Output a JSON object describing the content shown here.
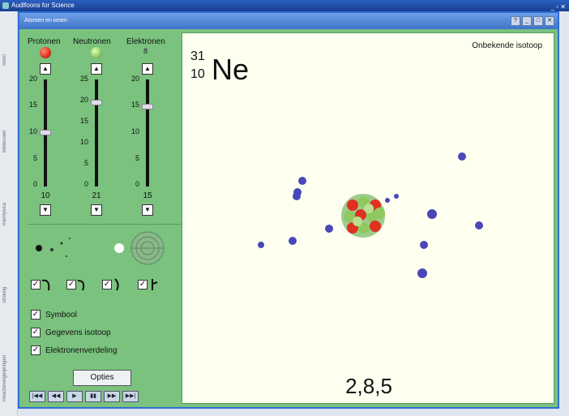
{
  "app": {
    "title": "Audlfoons for Science"
  },
  "window": {
    "title": "Atomen en ionen"
  },
  "left_tabs": [
    "Atom",
    "Moleculen",
    "Kernfysica",
    "Straling",
    "Reactievergelijkingen"
  ],
  "particles": {
    "protonen": {
      "label": "Protonen",
      "value": "10",
      "color": "#e03020"
    },
    "neutronen": {
      "label": "Neutronen",
      "value": "21",
      "color": "#90c860"
    },
    "elektronen": {
      "label": "Elektronen",
      "value": "15",
      "count_display": "8",
      "color": "#4848b8"
    }
  },
  "proton_ticks": [
    "20",
    "15",
    "10",
    "5",
    "0"
  ],
  "neutron_ticks": [
    "25",
    "20",
    "15",
    "10",
    "5",
    "0"
  ],
  "electron_ticks": [
    "20",
    "15",
    "10",
    "5",
    "0"
  ],
  "checks": [
    {
      "label": "Symbool",
      "checked": true
    },
    {
      "label": "Gegevens isotoop",
      "checked": true
    },
    {
      "label": "Elektronenverdeling",
      "checked": true
    }
  ],
  "opties_label": "Opties",
  "playbar": [
    "|◀◀",
    "◀◀",
    "▶",
    "▮▮",
    "▶▶",
    "▶▶|"
  ],
  "isotope": {
    "mass": "31",
    "number": "10",
    "symbol": "Ne"
  },
  "status": "Onbekende isotoop",
  "electron_config": "2,8,5"
}
